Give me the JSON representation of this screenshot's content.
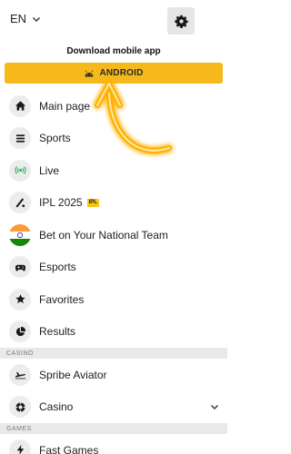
{
  "header": {
    "language": "EN",
    "download_title": "Download mobile app",
    "android_label": "ANDROID"
  },
  "menu": {
    "items": [
      {
        "label": "Main page",
        "icon": "home-icon"
      },
      {
        "label": "Sports",
        "icon": "sports-list-icon"
      },
      {
        "label": "Live",
        "icon": "live-broadcast-icon"
      },
      {
        "label": "IPL 2025",
        "icon": "cricket-icon",
        "badge": "IPL"
      },
      {
        "label": "Bet on Your National Team",
        "icon": "india-flag-icon"
      },
      {
        "label": "Esports",
        "icon": "gamepad-icon"
      },
      {
        "label": "Favorites",
        "icon": "star-icon"
      },
      {
        "label": "Results",
        "icon": "results-pie-icon"
      }
    ],
    "casino_section": "CASINO",
    "casino_items": [
      {
        "label": "Spribe Aviator",
        "icon": "airplane-icon"
      },
      {
        "label": "Casino",
        "icon": "casino-chip-icon"
      }
    ],
    "games_section": "GAMES",
    "games_items": [
      {
        "label": "Fast Games",
        "icon": "fast-games-icon"
      }
    ]
  },
  "colors": {
    "accent": "#f5b91c",
    "live_icon": "#22b14c",
    "badge": "#f5c518",
    "arrow_glow": "#ffb000"
  }
}
